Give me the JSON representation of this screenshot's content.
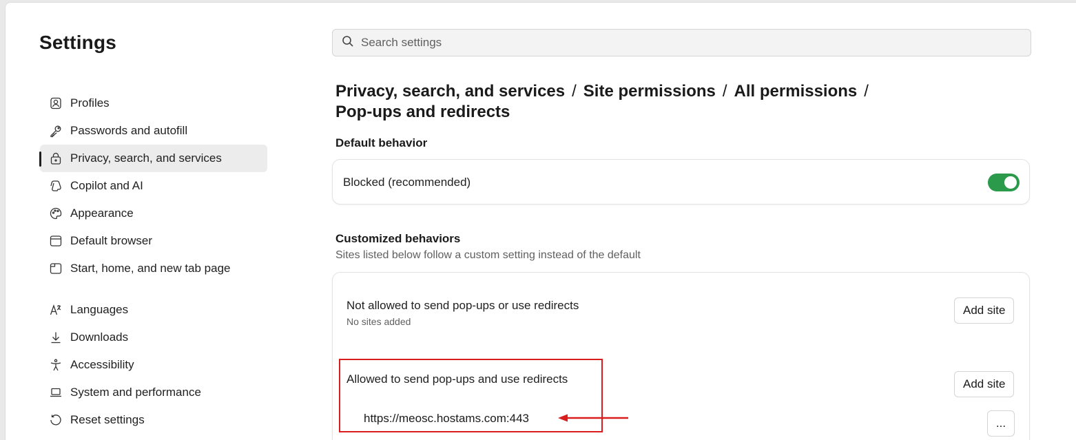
{
  "settings_title": "Settings",
  "search": {
    "placeholder": "Search settings"
  },
  "nav": [
    {
      "label": "Profiles",
      "icon": "profile-icon"
    },
    {
      "label": "Passwords and autofill",
      "icon": "key-icon"
    },
    {
      "label": "Privacy, search, and services",
      "icon": "lock-icon",
      "active": true
    },
    {
      "label": "Copilot and AI",
      "icon": "copilot-icon"
    },
    {
      "label": "Appearance",
      "icon": "palette-icon"
    },
    {
      "label": "Default browser",
      "icon": "browser-icon"
    },
    {
      "label": "Start, home, and new tab page",
      "icon": "home-tab-icon"
    },
    {
      "label": "Languages",
      "icon": "languages-icon"
    },
    {
      "label": "Downloads",
      "icon": "download-icon"
    },
    {
      "label": "Accessibility",
      "icon": "accessibility-icon"
    },
    {
      "label": "System and performance",
      "icon": "laptop-icon"
    },
    {
      "label": "Reset settings",
      "icon": "reset-icon"
    }
  ],
  "breadcrumb": {
    "items": [
      "Privacy, search, and services",
      "Site permissions",
      "All permissions",
      "Pop-ups and redirects"
    ],
    "separator": "/"
  },
  "default_behavior": {
    "heading": "Default behavior",
    "label": "Blocked (recommended)",
    "toggle_on": true
  },
  "customized": {
    "heading": "Customized behaviors",
    "subtitle": "Sites listed below follow a custom setting instead of the default",
    "not_allowed": {
      "label": "Not allowed to send pop-ups or use redirects",
      "sub": "No sites added",
      "button": "Add site"
    },
    "allowed": {
      "label": "Allowed to send pop-ups and use redirects",
      "button": "Add site",
      "site": "https://meosc.hostams.com:443",
      "more": "..."
    }
  },
  "colors": {
    "toggle_on": "#2c9a4b",
    "highlight": "#d91c1c"
  }
}
